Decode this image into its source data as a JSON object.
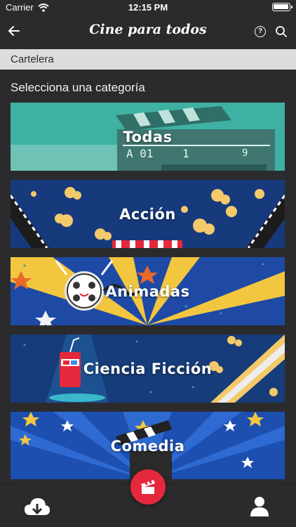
{
  "status": {
    "carrier": "Carrier",
    "time": "12:15 PM",
    "battery_level": 1.0
  },
  "header": {
    "title": "Cine para todos",
    "help_glyph": "?"
  },
  "section": {
    "label": "Cartelera"
  },
  "prompt": "Selecciona una categoría",
  "categories": [
    {
      "label": "Todas"
    },
    {
      "label": "Acción"
    },
    {
      "label": "Animadas"
    },
    {
      "label": "Ciencia Ficción"
    },
    {
      "label": "Comedia"
    }
  ],
  "colors": {
    "accent": "#e5283b",
    "background": "#2b2b2d",
    "section_bar": "#ddddde"
  },
  "icons": {
    "back": "arrow-left-icon",
    "help": "help-circle-icon",
    "search": "search-icon",
    "download": "cloud-download-icon",
    "profile": "user-icon",
    "fab": "clapperboard-icon"
  }
}
